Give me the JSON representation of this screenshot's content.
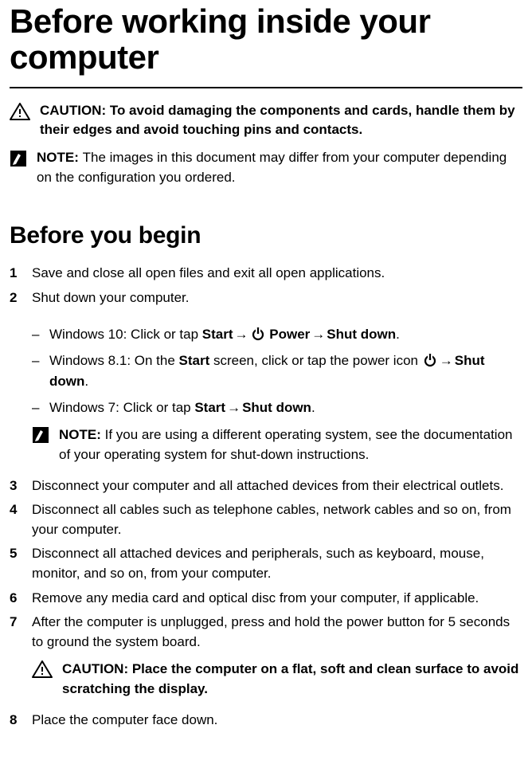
{
  "title": "Before working inside your computer",
  "caution1": {
    "label": "CAUTION: ",
    "body": "To avoid damaging the components and cards, handle them by their edges and avoid touching pins and contacts."
  },
  "note1": {
    "label": "NOTE: ",
    "body": "The images in this document may differ from your computer depending on the configuration you ordered."
  },
  "h2": "Before you begin",
  "steps": {
    "s1": {
      "num": "1",
      "text": "Save and close all open files and exit all open applications."
    },
    "s2": {
      "num": "2",
      "text": "Shut down your computer.",
      "sub": {
        "a_pre": "Windows 10: Click or tap ",
        "a_start": "Start",
        "a_arr1": " → ",
        "a_power": " Power",
        "a_arr2": " → ",
        "a_shut": "Shut down",
        "a_post": ".",
        "b_pre": "Windows 8.1: On the ",
        "b_start": "Start",
        "b_mid": " screen, click or tap the power icon ",
        "b_arr": " → ",
        "b_shut": "Shut down",
        "b_post": ".",
        "c_pre": "Windows 7: Click or tap ",
        "c_start": "Start",
        "c_arr": " → ",
        "c_shut": "Shut down",
        "c_post": "."
      },
      "note": {
        "label": "NOTE: ",
        "body": "If you are using a different operating system, see the documentation of your operating system for shut-down instructions."
      }
    },
    "s3": {
      "num": "3",
      "text": "Disconnect your computer and all attached devices from their electrical outlets."
    },
    "s4": {
      "num": "4",
      "text": "Disconnect all cables such as telephone cables, network cables and so on, from your computer."
    },
    "s5": {
      "num": "5",
      "text": "Disconnect all attached devices and peripherals, such as keyboard, mouse, monitor, and so on, from your computer."
    },
    "s6": {
      "num": "6",
      "text": "Remove any media card and optical disc from your computer, if applicable."
    },
    "s7": {
      "num": "7",
      "text": "After the computer is unplugged, press and hold the power button for 5 seconds to ground the system board.",
      "caution": {
        "label": "CAUTION: ",
        "body": "Place the computer on a flat, soft and clean surface to avoid scratching the display."
      }
    },
    "s8": {
      "num": "8",
      "text": "Place the computer face down."
    }
  }
}
